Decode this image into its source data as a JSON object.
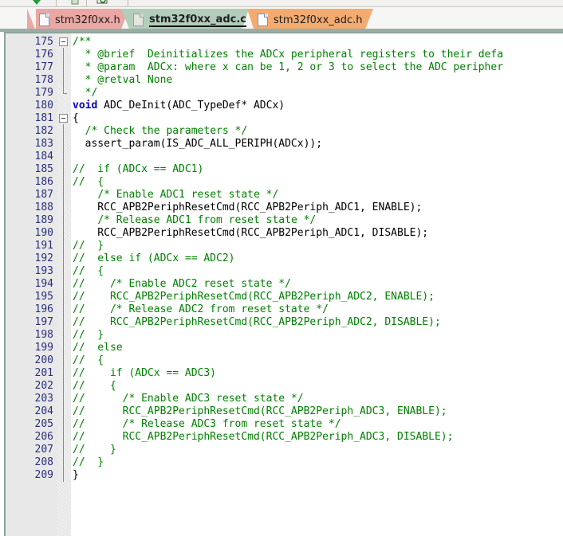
{
  "window": {
    "toolbar_icons": [
      "dropdown-arrow-icon",
      "clipboard-icon",
      "find-icon"
    ]
  },
  "tabs": [
    {
      "label": "stm32f0xx.h",
      "icon": "file-icon",
      "active": false,
      "color": "#eaa7a4"
    },
    {
      "label": "stm32f0xx_adc.c",
      "icon": "file-icon",
      "active": true,
      "color": "#b2ceba"
    },
    {
      "label": "stm32f0xx_adc.h",
      "icon": "file-icon",
      "active": false,
      "color": "#f3ab6f"
    }
  ],
  "editor": {
    "first_line_number": 175,
    "syntax_colors": {
      "comment": "#008000",
      "keyword": "#0000d0",
      "plain": "#000000",
      "line_number": "#28307c",
      "gutter_background": "#e8e8e8"
    },
    "lines": [
      {
        "n": 175,
        "segments": [
          {
            "t": "/**",
            "c": "cm"
          }
        ],
        "fold": "start"
      },
      {
        "n": 176,
        "segments": [
          {
            "t": "  * @brief  Deinitializes the ADCx peripheral registers to their defa",
            "c": "cm"
          }
        ]
      },
      {
        "n": 177,
        "segments": [
          {
            "t": "  * @param  ADCx: where x can be 1, 2 or 3 to select the ADC peripher",
            "c": "cm"
          }
        ]
      },
      {
        "n": 178,
        "segments": [
          {
            "t": "  * @retval None",
            "c": "cm"
          }
        ]
      },
      {
        "n": 179,
        "segments": [
          {
            "t": "  */",
            "c": "cm"
          }
        ],
        "fold": "end"
      },
      {
        "n": 180,
        "segments": [
          {
            "t": "void",
            "c": "kw"
          },
          {
            "t": " ADC_DeInit(ADC_TypeDef* ADCx)",
            "c": ""
          }
        ]
      },
      {
        "n": 181,
        "segments": [
          {
            "t": "{",
            "c": ""
          }
        ],
        "fold": "start"
      },
      {
        "n": 182,
        "segments": [
          {
            "t": "  ",
            "c": ""
          },
          {
            "t": "/* Check the parameters */",
            "c": "cm"
          }
        ]
      },
      {
        "n": 183,
        "segments": [
          {
            "t": "  assert_param(IS_ADC_ALL_PERIPH(ADCx));",
            "c": ""
          }
        ]
      },
      {
        "n": 184,
        "segments": [
          {
            "t": "",
            "c": ""
          }
        ]
      },
      {
        "n": 185,
        "segments": [
          {
            "t": "//  if (ADCx == ADC1)",
            "c": "cm"
          }
        ]
      },
      {
        "n": 186,
        "segments": [
          {
            "t": "//  {",
            "c": "cm"
          }
        ]
      },
      {
        "n": 187,
        "segments": [
          {
            "t": "    ",
            "c": ""
          },
          {
            "t": "/* Enable ADC1 reset state */",
            "c": "cm"
          }
        ]
      },
      {
        "n": 188,
        "segments": [
          {
            "t": "    RCC_APB2PeriphResetCmd(RCC_APB2Periph_ADC1, ENABLE);",
            "c": ""
          }
        ]
      },
      {
        "n": 189,
        "segments": [
          {
            "t": "    ",
            "c": ""
          },
          {
            "t": "/* Release ADC1 from reset state */",
            "c": "cm"
          }
        ]
      },
      {
        "n": 190,
        "segments": [
          {
            "t": "    RCC_APB2PeriphResetCmd(RCC_APB2Periph_ADC1, DISABLE);",
            "c": ""
          }
        ]
      },
      {
        "n": 191,
        "segments": [
          {
            "t": "//  }",
            "c": "cm"
          }
        ]
      },
      {
        "n": 192,
        "segments": [
          {
            "t": "//  else if (ADCx == ADC2)",
            "c": "cm"
          }
        ]
      },
      {
        "n": 193,
        "segments": [
          {
            "t": "//  {",
            "c": "cm"
          }
        ]
      },
      {
        "n": 194,
        "segments": [
          {
            "t": "//    /* Enable ADC2 reset state */",
            "c": "cm"
          }
        ]
      },
      {
        "n": 195,
        "segments": [
          {
            "t": "//    RCC_APB2PeriphResetCmd(RCC_APB2Periph_ADC2, ENABLE);",
            "c": "cm"
          }
        ]
      },
      {
        "n": 196,
        "segments": [
          {
            "t": "//    /* Release ADC2 from reset state */",
            "c": "cm"
          }
        ]
      },
      {
        "n": 197,
        "segments": [
          {
            "t": "//    RCC_APB2PeriphResetCmd(RCC_APB2Periph_ADC2, DISABLE);",
            "c": "cm"
          }
        ]
      },
      {
        "n": 198,
        "segments": [
          {
            "t": "//  }",
            "c": "cm"
          }
        ]
      },
      {
        "n": 199,
        "segments": [
          {
            "t": "//  else",
            "c": "cm"
          }
        ]
      },
      {
        "n": 200,
        "segments": [
          {
            "t": "//  {",
            "c": "cm"
          }
        ]
      },
      {
        "n": 201,
        "segments": [
          {
            "t": "//    if (ADCx == ADC3)",
            "c": "cm"
          }
        ]
      },
      {
        "n": 202,
        "segments": [
          {
            "t": "//    {",
            "c": "cm"
          }
        ]
      },
      {
        "n": 203,
        "segments": [
          {
            "t": "//      /* Enable ADC3 reset state */",
            "c": "cm"
          }
        ]
      },
      {
        "n": 204,
        "segments": [
          {
            "t": "//      RCC_APB2PeriphResetCmd(RCC_APB2Periph_ADC3, ENABLE);",
            "c": "cm"
          }
        ]
      },
      {
        "n": 205,
        "segments": [
          {
            "t": "//      /* Release ADC3 from reset state */",
            "c": "cm"
          }
        ]
      },
      {
        "n": 206,
        "segments": [
          {
            "t": "//      RCC_APB2PeriphResetCmd(RCC_APB2Periph_ADC3, DISABLE);",
            "c": "cm"
          }
        ]
      },
      {
        "n": 207,
        "segments": [
          {
            "t": "//    }",
            "c": "cm"
          }
        ]
      },
      {
        "n": 208,
        "segments": [
          {
            "t": "//  }",
            "c": "cm"
          }
        ]
      },
      {
        "n": 209,
        "segments": [
          {
            "t": "}",
            "c": ""
          }
        ]
      }
    ]
  }
}
